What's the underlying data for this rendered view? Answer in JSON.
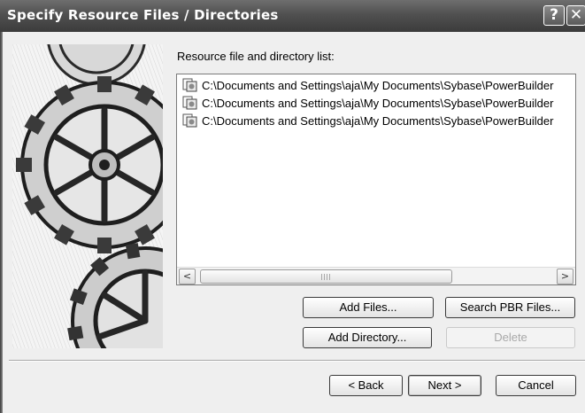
{
  "window": {
    "title": "Specify Resource Files / Directories",
    "help_glyph": "?",
    "close_glyph": "✕"
  },
  "list_section": {
    "label": "Resource file and directory list:",
    "items": [
      {
        "icon": "resource-file-icon",
        "path": "C:\\Documents and Settings\\aja\\My Documents\\Sybase\\PowerBuilder"
      },
      {
        "icon": "resource-file-icon",
        "path": "C:\\Documents and Settings\\aja\\My Documents\\Sybase\\PowerBuilder"
      },
      {
        "icon": "resource-file-icon",
        "path": "C:\\Documents and Settings\\aja\\My Documents\\Sybase\\PowerBuilder"
      }
    ]
  },
  "scrollbar": {
    "left_arrow": "<",
    "right_arrow": ">",
    "position": 0.0
  },
  "actions": {
    "add_files": "Add Files...",
    "search_pbr": "Search PBR Files...",
    "add_directory": "Add Directory...",
    "delete": "Delete"
  },
  "wizard": {
    "back": "< Back",
    "next": "Next >",
    "cancel": "Cancel"
  }
}
